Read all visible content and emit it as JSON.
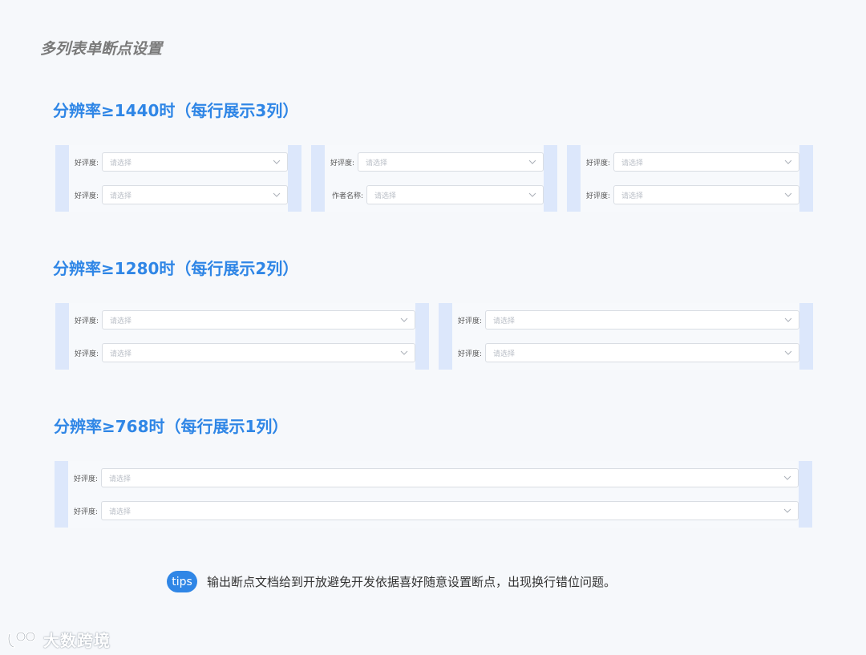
{
  "page_title": "多列表单断点设置",
  "sections": [
    {
      "title": "分辨率≥1440时（每行展示3列）",
      "panels": [
        {
          "rows": [
            {
              "label": "好评度:",
              "placeholder": "请选择"
            },
            {
              "label": "好评度:",
              "placeholder": "请选择"
            }
          ]
        },
        {
          "rows": [
            {
              "label": "好评度:",
              "placeholder": "请选择"
            },
            {
              "label": "作者名称:",
              "placeholder": "请选择"
            }
          ]
        },
        {
          "rows": [
            {
              "label": "好评度:",
              "placeholder": "请选择"
            },
            {
              "label": "好评度:",
              "placeholder": "请选择"
            }
          ]
        }
      ]
    },
    {
      "title": "分辨率≥1280时（每行展示2列）",
      "panels": [
        {
          "rows": [
            {
              "label": "好评度:",
              "placeholder": "请选择"
            },
            {
              "label": "好评度:",
              "placeholder": "请选择"
            }
          ]
        },
        {
          "rows": [
            {
              "label": "好评度:",
              "placeholder": "请选择"
            },
            {
              "label": "好评度:",
              "placeholder": "请选择"
            }
          ]
        }
      ]
    },
    {
      "title": "分辨率≥768时（每行展示1列）",
      "panels": [
        {
          "rows": [
            {
              "label": "好评度:",
              "placeholder": "请选择"
            },
            {
              "label": "好评度:",
              "placeholder": "请选择"
            }
          ]
        }
      ]
    }
  ],
  "tips": {
    "badge": "tips",
    "text": "输出断点文档给到开放避免开发依据喜好随意设置断点，出现换行错位问题。"
  },
  "watermark": "大数跨境",
  "colors": {
    "accent": "#2f86e6",
    "panel_edge": "#dce7fb",
    "placeholder": "#b9bec6"
  }
}
